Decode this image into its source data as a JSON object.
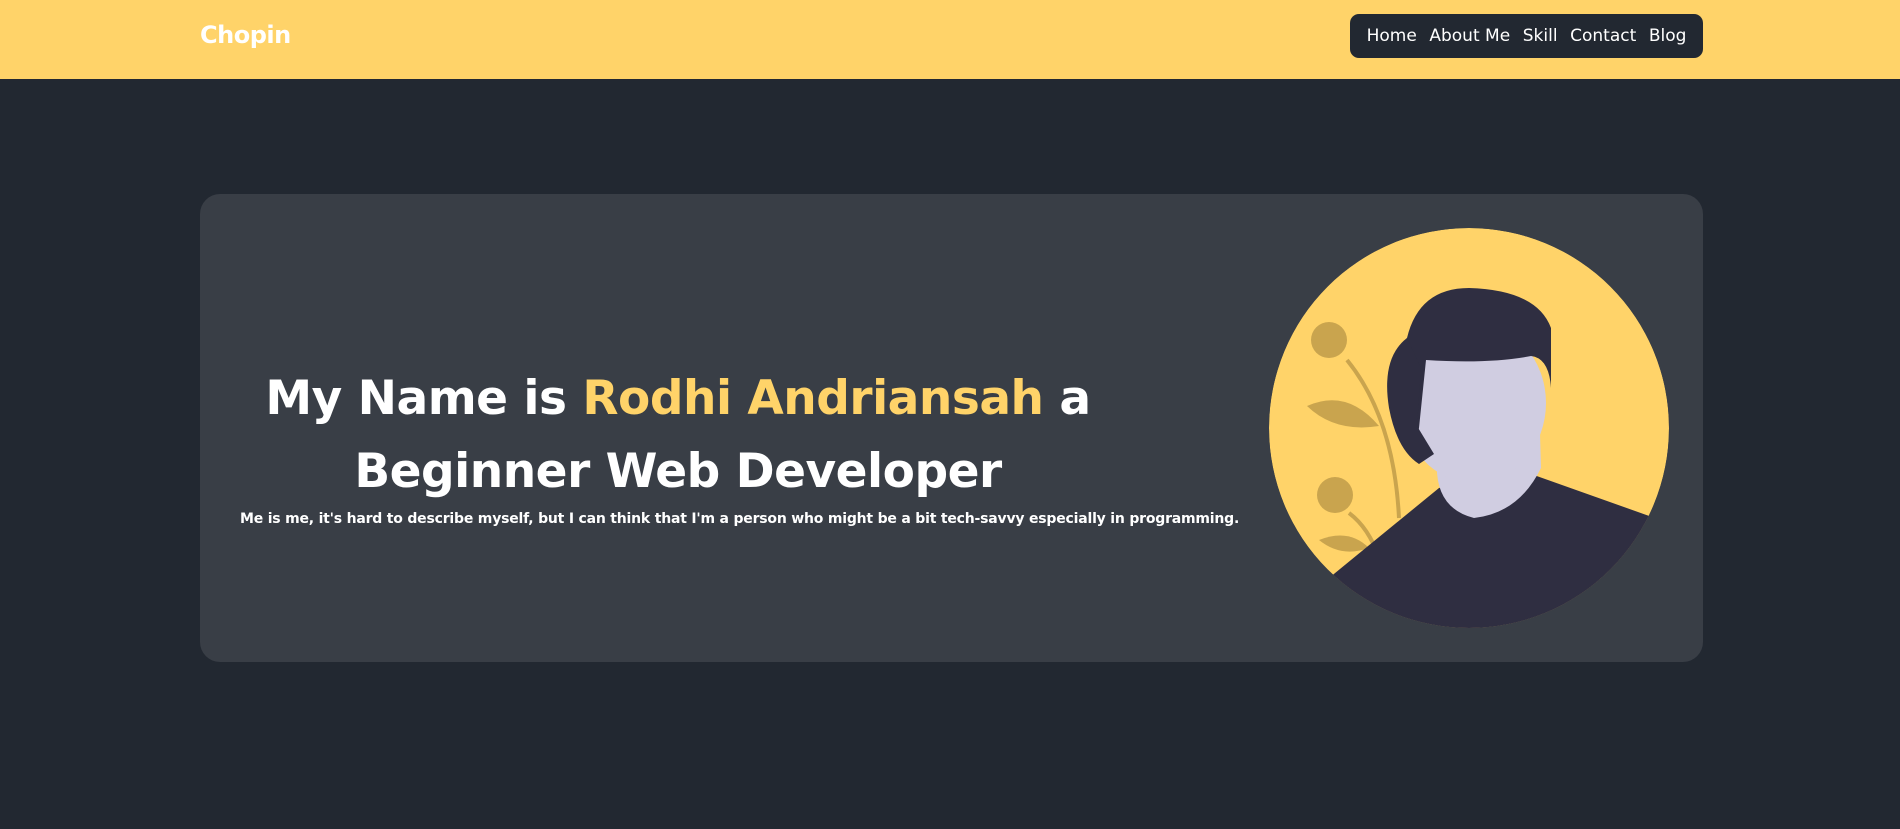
{
  "header": {
    "brand": "Chopin",
    "nav": [
      "Home",
      "About Me",
      "Skill",
      "Contact",
      "Blog"
    ]
  },
  "hero": {
    "headline_prefix": "My Name is ",
    "name": "Rodhi Andriansah",
    "headline_suffix_1": " a",
    "headline_line_2": "Beginner Web Developer",
    "description": "Me is me, it's hard to describe myself, but I can think that I'm a person who might be a bit tech-savvy especially in programming."
  },
  "colors": {
    "accent": "#FFD369",
    "background": "#222831",
    "card": "#393E46",
    "text": "#FFFFFF"
  }
}
